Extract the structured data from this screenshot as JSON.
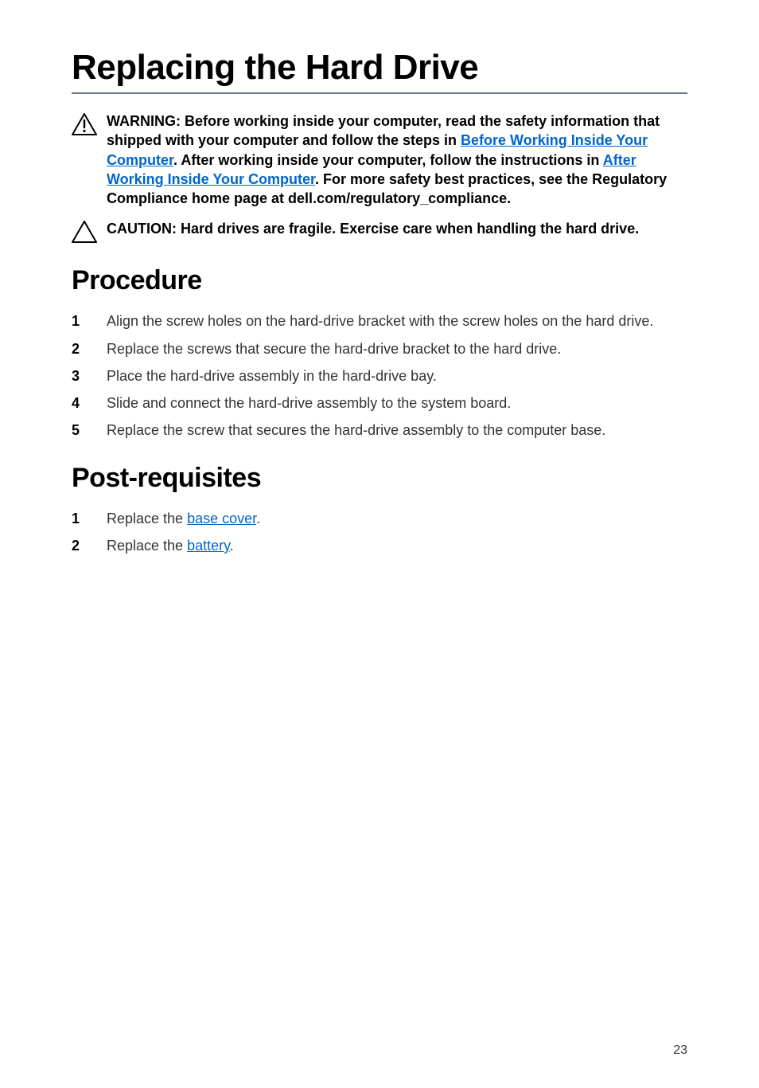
{
  "title": "Replacing the Hard Drive",
  "warning": {
    "pre1": "WARNING: Before working inside your computer, read the safety information that shipped with your computer and follow the steps in ",
    "link1": "Before Working Inside Your Computer",
    "mid1": ". After working inside your computer, follow the instructions in ",
    "link2": "After Working Inside Your Computer",
    "post1": ". For more safety best practices, see the Regulatory Compliance home page at dell.com/regulatory_compliance."
  },
  "caution": "CAUTION: Hard drives are fragile. Exercise care when handling the hard drive.",
  "procedure_heading": "Procedure",
  "procedure_steps": [
    "Align the screw holes on the hard-drive bracket with the screw holes on the hard drive.",
    "Replace the screws that secure the hard-drive bracket to the hard drive.",
    "Place the hard-drive assembly in the hard-drive bay.",
    "Slide and connect the hard-drive assembly to the system board.",
    "Replace the screw that secures the hard-drive assembly to the computer base."
  ],
  "postreq_heading": "Post-requisites",
  "postreq": [
    {
      "pre": "Replace the ",
      "link": "base cover",
      "post": "."
    },
    {
      "pre": "Replace the ",
      "link": "battery",
      "post": "."
    }
  ],
  "page_number": "23"
}
